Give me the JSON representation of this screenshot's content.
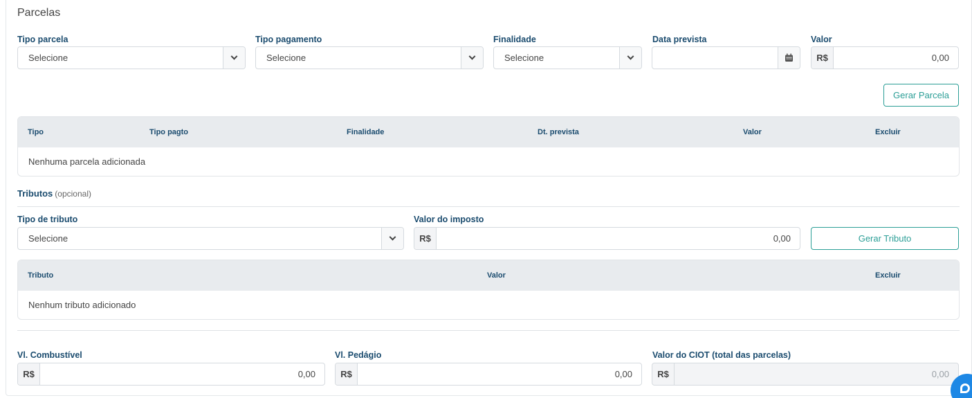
{
  "parcelas": {
    "title": "Parcelas",
    "tipo_parcela": {
      "label": "Tipo parcela",
      "value": "Selecione"
    },
    "tipo_pagamento": {
      "label": "Tipo pagamento",
      "value": "Selecione"
    },
    "finalidade": {
      "label": "Finalidade",
      "value": "Selecione"
    },
    "data_prevista": {
      "label": "Data prevista",
      "value": ""
    },
    "valor": {
      "label": "Valor",
      "prefix": "R$",
      "value": "0,00"
    },
    "gerar_button": "Gerar Parcela",
    "table": {
      "headers": [
        "Tipo",
        "Tipo pagto",
        "Finalidade",
        "Dt. prevista",
        "Valor",
        "Excluir"
      ],
      "empty": "Nenhuma parcela adicionada"
    }
  },
  "tributos": {
    "title": "Tributos",
    "optional": "(opcional)",
    "tipo_tributo": {
      "label": "Tipo de tributo",
      "value": "Selecione"
    },
    "valor_imposto": {
      "label": "Valor do imposto",
      "prefix": "R$",
      "value": "0,00"
    },
    "gerar_button": "Gerar Tributo",
    "table": {
      "headers": [
        "Tributo",
        "Valor",
        "Excluir"
      ],
      "empty": "Nenhum tributo adicionado"
    }
  },
  "totais": {
    "combustivel": {
      "label": "Vl. Combustível",
      "prefix": "R$",
      "value": "0,00"
    },
    "pedagio": {
      "label": "Vl. Pedágio",
      "prefix": "R$",
      "value": "0,00"
    },
    "ciot": {
      "label": "Valor do CIOT (total das parcelas)",
      "prefix": "R$",
      "value": "0,00"
    }
  },
  "icons": {
    "calendar": "calendar-icon",
    "chevron": "chevron-down-icon",
    "chat": "chat-icon"
  },
  "colors": {
    "accent": "#2b9e96",
    "label": "#1a4b6e",
    "chat": "#1e88e5"
  }
}
